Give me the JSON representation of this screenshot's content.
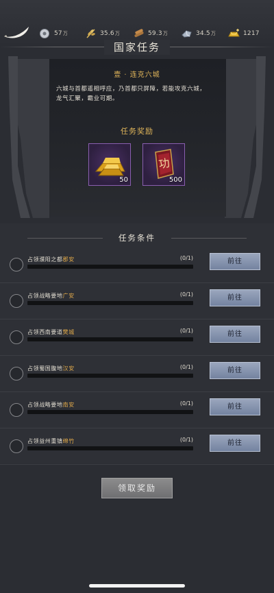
{
  "header": {
    "back_icon": "scimitar-back-icon",
    "resources": [
      {
        "icon": "silver-coin-icon",
        "value": "57",
        "unit": "万"
      },
      {
        "icon": "grain-icon",
        "value": "35.6",
        "unit": "万"
      },
      {
        "icon": "wood-icon",
        "value": "59.3",
        "unit": "万"
      },
      {
        "icon": "iron-ore-icon",
        "value": "34.5",
        "unit": "万"
      },
      {
        "icon": "gold-ingot-plus-icon",
        "value": "1217",
        "unit": ""
      }
    ]
  },
  "page": {
    "title": "国家任务"
  },
  "mission": {
    "name": "壹 · 连克六城",
    "description_lines": [
      "六城与首都遥相呼应，乃首都只屏障，若能攻克六城，",
      "龙气汇聚，霸业可期。"
    ],
    "reward_title": "任务奖励",
    "rewards": [
      {
        "icon": "gold-bar-icon",
        "count": "50"
      },
      {
        "icon": "merit-token-icon",
        "count": "500",
        "glyph": "功"
      }
    ]
  },
  "conditions": {
    "title": "任务条件",
    "go_label": "前往",
    "items": [
      {
        "text": "占领濮阳之都",
        "place": "郡安",
        "progress": "(0/1)"
      },
      {
        "text": "占领战略要地",
        "place": "广安",
        "progress": "(0/1)"
      },
      {
        "text": "占领西南要道",
        "place": "樊城",
        "progress": "(0/1)"
      },
      {
        "text": "占领蜀国腹地",
        "place": "汉安",
        "progress": "(0/1)"
      },
      {
        "text": "占领战略要地",
        "place": "南安",
        "progress": "(0/1)"
      },
      {
        "text": "占领益州重镇",
        "place": "绵竹",
        "progress": "(0/1)"
      }
    ]
  },
  "claim": {
    "label": "领取奖励"
  },
  "colors": {
    "gold_text": "#e0b55a",
    "place_text": "#e0a94a",
    "button_blue": "#8594b0",
    "reward_frame": "#8a5fb0"
  }
}
